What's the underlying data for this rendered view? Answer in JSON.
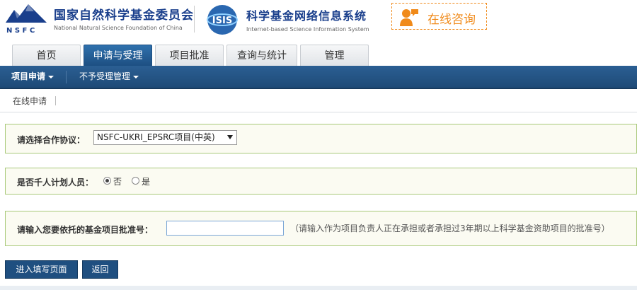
{
  "header": {
    "nsfc_name_cn": "国家自然科学基金委员会",
    "nsfc_name_en": "National Natural Science Foundation of China",
    "nsfc_abbrev": "N S F C",
    "isis_logo_text": "ISIS",
    "isis_name_cn": "科学基金网络信息系统",
    "isis_name_en": "Internet-based Science Information System",
    "consult_label": "在线咨询"
  },
  "tabs": [
    {
      "label": "首页",
      "active": false
    },
    {
      "label": "申请与受理",
      "active": true
    },
    {
      "label": "项目批准",
      "active": false
    },
    {
      "label": "查询与统计",
      "active": false
    },
    {
      "label": "管理",
      "active": false
    }
  ],
  "nav": {
    "items": [
      {
        "label": "项目申请",
        "active": true
      },
      {
        "label": "不予受理管理",
        "active": false
      }
    ]
  },
  "subnav": {
    "items": [
      {
        "label": "在线申请"
      }
    ]
  },
  "form": {
    "protocol": {
      "label": "请选择合作协议：",
      "selected": "NSFC-UKRI_EPSRC项目(中英)"
    },
    "talent": {
      "label": "是否千人计划人员：",
      "options": [
        {
          "label": "否",
          "checked": true
        },
        {
          "label": "是",
          "checked": false
        }
      ]
    },
    "grant": {
      "label": "请输入您要依托的基金项目批准号：",
      "value": "",
      "hint": "（请输入作为项目负责人正在承担或者承担过3年期以上科学基金资助项目的批准号）"
    }
  },
  "buttons": {
    "enter": "进入填写页面",
    "back": "返回"
  },
  "colors": {
    "brand_blue": "#1e4a77",
    "accent_orange": "#f08a1a",
    "panel_border": "#a9c97a"
  }
}
